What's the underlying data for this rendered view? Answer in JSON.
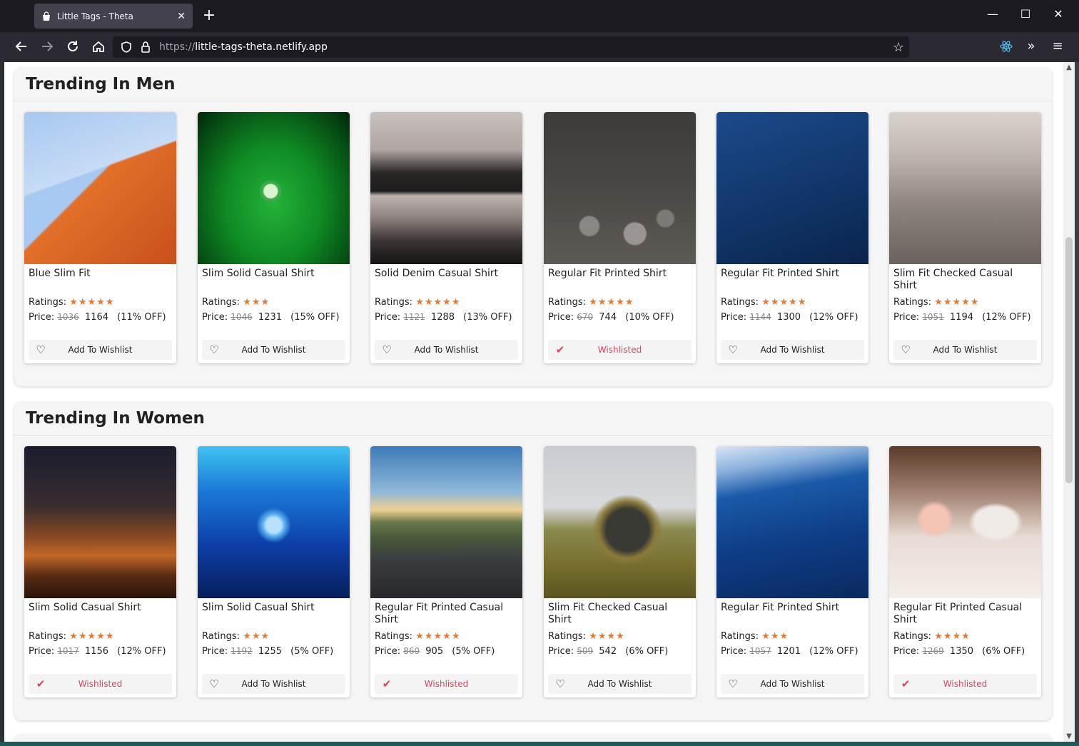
{
  "browser": {
    "tab_title": "Little Tags - Theta",
    "url_prefix": "https://",
    "url_host": "little-tags-theta.netlify.app"
  },
  "sections": [
    {
      "title": "Trending In Men",
      "products": [
        {
          "name": "Blue Slim Fit",
          "ratings_label": "Ratings:",
          "stars": "★★★★★",
          "price_label": "Price:",
          "old_price": "1036",
          "new_price": "1164",
          "discount": "(11% OFF)",
          "wish_label": "Add To Wishlist",
          "wishlisted": false,
          "image": "desert-dune-icon"
        },
        {
          "name": "Slim Solid Casual Shirt",
          "ratings_label": "Ratings:",
          "stars": "★★★",
          "price_label": "Price:",
          "old_price": "1046",
          "new_price": "1231",
          "discount": "(15% OFF)",
          "wish_label": "Add To Wishlist",
          "wishlisted": false,
          "image": "leaf-droplet-icon"
        },
        {
          "name": "Solid Denim Casual Shirt",
          "ratings_label": "Ratings:",
          "stars": "★★★★★",
          "price_label": "Price:",
          "old_price": "1121",
          "new_price": "1288",
          "discount": "(13% OFF)",
          "wish_label": "Add To Wishlist",
          "wishlisted": false,
          "image": "forest-lake-icon"
        },
        {
          "name": "Regular Fit Printed Shirt",
          "ratings_label": "Ratings:",
          "stars": "★★★★★",
          "price_label": "Price:",
          "old_price": "670",
          "new_price": "744",
          "discount": "(10% OFF)",
          "wish_label": "Wishlisted",
          "wishlisted": true,
          "image": "river-stones-icon"
        },
        {
          "name": "Regular Fit Printed Shirt",
          "ratings_label": "Ratings:",
          "stars": "★★★★★",
          "price_label": "Price:",
          "old_price": "1144",
          "new_price": "1300",
          "discount": "(12% OFF)",
          "wish_label": "Add To Wishlist",
          "wishlisted": false,
          "image": "ocean-water-icon"
        },
        {
          "name": "Slim Fit Checked Casual Shirt",
          "ratings_label": "Ratings:",
          "stars": "★★★★★",
          "price_label": "Price:",
          "old_price": "1051",
          "new_price": "1194",
          "discount": "(12% OFF)",
          "wish_label": "Add To Wishlist",
          "wishlisted": false,
          "image": "city-aerial-icon"
        }
      ]
    },
    {
      "title": "Trending In Women",
      "products": [
        {
          "name": "Slim Solid Casual Shirt",
          "ratings_label": "Ratings:",
          "stars": "★★★★★",
          "price_label": "Price:",
          "old_price": "1017",
          "new_price": "1156",
          "discount": "(12% OFF)",
          "wish_label": "Wishlisted",
          "wishlisted": true,
          "image": "night-desert-icon"
        },
        {
          "name": "Slim Solid Casual Shirt",
          "ratings_label": "Ratings:",
          "stars": "★★★",
          "price_label": "Price:",
          "old_price": "1192",
          "new_price": "1255",
          "discount": "(5% OFF)",
          "wish_label": "Add To Wishlist",
          "wishlisted": false,
          "image": "jellyfish-icon"
        },
        {
          "name": "Regular Fit Printed Casual Shirt",
          "ratings_label": "Ratings:",
          "stars": "★★★★★",
          "price_label": "Price:",
          "old_price": "860",
          "new_price": "905",
          "discount": "(5% OFF)",
          "wish_label": "Wishlisted",
          "wishlisted": true,
          "image": "mountain-road-icon"
        },
        {
          "name": "Slim Fit Checked Casual Shirt",
          "ratings_label": "Ratings:",
          "stars": "★★★★",
          "price_label": "Price:",
          "old_price": "509",
          "new_price": "542",
          "discount": "(6% OFF)",
          "wish_label": "Add To Wishlist",
          "wishlisted": false,
          "image": "old-truck-icon"
        },
        {
          "name": "Regular Fit Printed Shirt",
          "ratings_label": "Ratings:",
          "stars": "★★★",
          "price_label": "Price:",
          "old_price": "1057",
          "new_price": "1201",
          "discount": "(12% OFF)",
          "wish_label": "Add To Wishlist",
          "wishlisted": false,
          "image": "blue-wave-icon"
        },
        {
          "name": "Regular Fit Printed Casual Shirt",
          "ratings_label": "Ratings:",
          "stars": "★★★★",
          "price_label": "Price:",
          "old_price": "1269",
          "new_price": "1350",
          "discount": "(6% OFF)",
          "wish_label": "Wishlisted",
          "wishlisted": true,
          "image": "teacup-flower-icon"
        }
      ]
    }
  ],
  "colors": {
    "star": "#e8782f",
    "wishlisted": "#e0405e",
    "section_bg": "#f5f5f5"
  }
}
